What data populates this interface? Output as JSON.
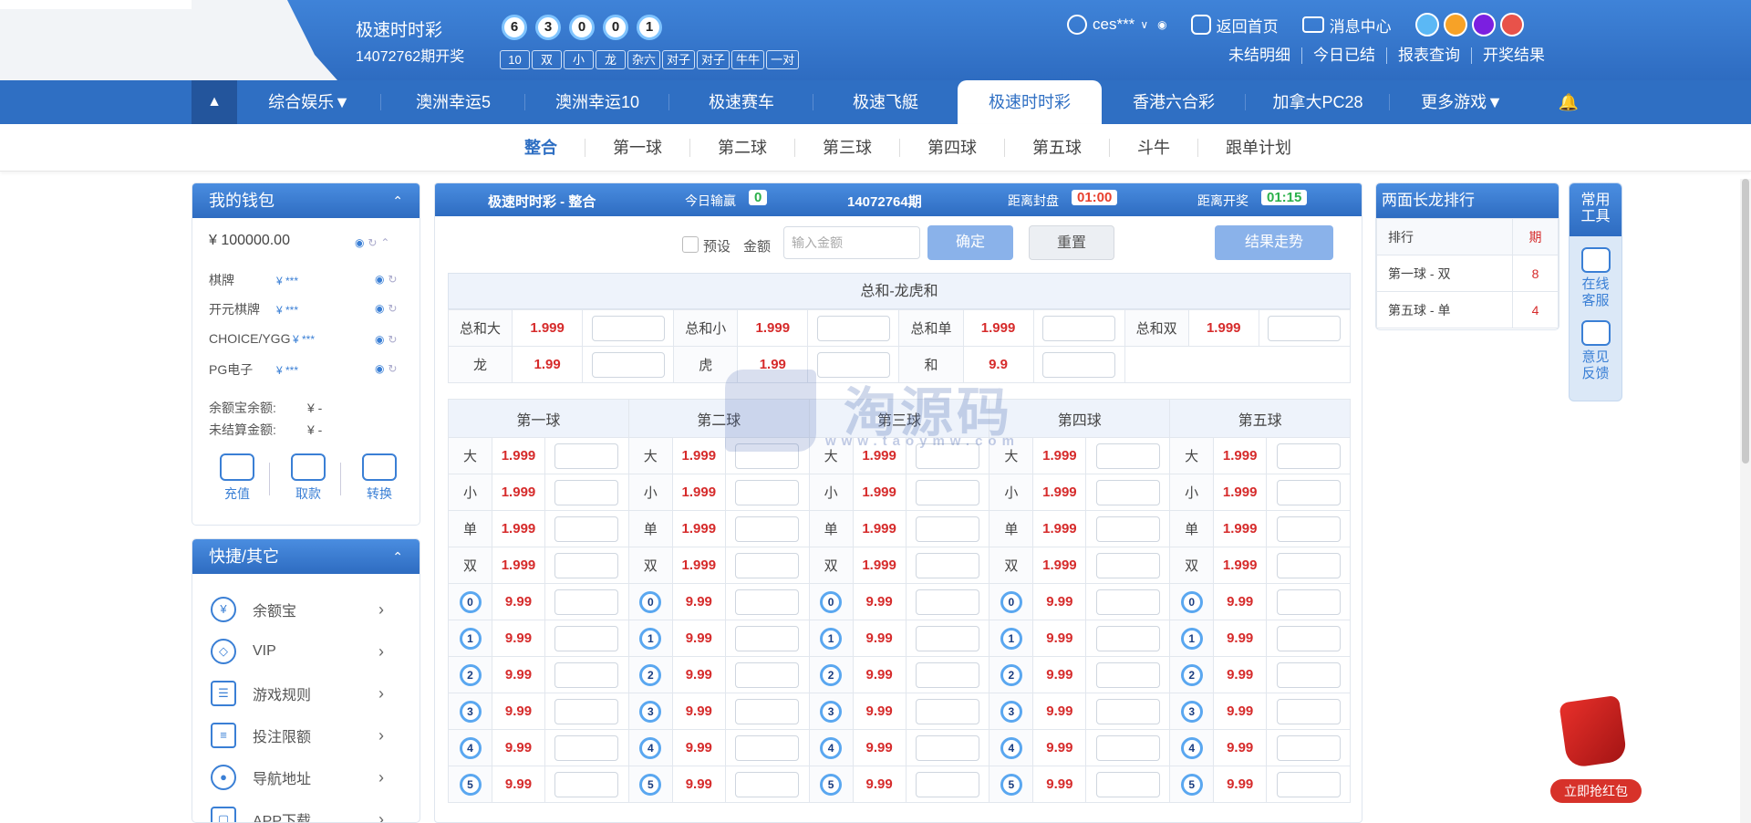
{
  "header": {
    "game_name": "极速时时彩",
    "period_open": "14072762期开奖",
    "balls": [
      "6",
      "3",
      "0",
      "0",
      "1"
    ],
    "tags": [
      "10",
      "双",
      "小",
      "龙",
      "杂六",
      "对子",
      "对子",
      "牛牛",
      "一对"
    ],
    "user": "ces***",
    "home_link": "返回首页",
    "message_center": "消息中心",
    "theme_colors": [
      "#5bb8f5",
      "#f7a227",
      "#7b1fe0",
      "#e8524a"
    ],
    "links": [
      "未结明细",
      "今日已结",
      "报表查询",
      "开奖结果"
    ]
  },
  "nav": {
    "items": [
      {
        "label": "综合娱乐▼"
      },
      {
        "label": "澳洲幸运5"
      },
      {
        "label": "澳洲幸运10"
      },
      {
        "label": "极速赛车"
      },
      {
        "label": "极速飞艇"
      },
      {
        "label": "极速时时彩",
        "active": true
      },
      {
        "label": "香港六合彩"
      },
      {
        "label": "加拿大PC28"
      },
      {
        "label": "更多游戏▼"
      }
    ]
  },
  "subnav": {
    "items": [
      "整合",
      "第一球",
      "第二球",
      "第三球",
      "第四球",
      "第五球",
      "斗牛",
      "跟单计划"
    ],
    "active": "整合"
  },
  "wallet": {
    "title": "我的钱包",
    "balance": "¥ 100000.00",
    "accounts": [
      {
        "name": "棋牌",
        "value": "¥ ***"
      },
      {
        "name": "开元棋牌",
        "value": "¥ ***"
      },
      {
        "name": "CHOICE/YGG",
        "value": "¥ ***"
      },
      {
        "name": "PG电子",
        "value": "¥ ***"
      }
    ],
    "yuebao_label": "余额宝余额:",
    "yuebao_value": "¥ -",
    "unsettled_label": "未结算金额:",
    "unsettled_value": "¥ -",
    "buttons": [
      "充值",
      "取款",
      "转换"
    ]
  },
  "quick": {
    "title": "快捷/其它",
    "items": [
      {
        "label": "余额宝",
        "icon": "coin-bag-icon"
      },
      {
        "label": "VIP",
        "icon": "diamond-icon"
      },
      {
        "label": "游戏规则",
        "icon": "rules-icon"
      },
      {
        "label": "投注限额",
        "icon": "sliders-icon"
      },
      {
        "label": "导航地址",
        "icon": "location-icon"
      },
      {
        "label": "APP下载",
        "icon": "app-icon"
      }
    ]
  },
  "main": {
    "title": "极速时时彩 - 整合",
    "today_label": "今日输赢",
    "today_value": "0",
    "period": "14072764期",
    "close_label": "距离封盘",
    "close_time": "01:00",
    "open_label": "距离开奖",
    "open_time": "01:15",
    "preset_label": "预设",
    "amount_label": "金额",
    "amount_placeholder": "输入金额",
    "confirm": "确定",
    "reset": "重置",
    "trend": "结果走势",
    "sum_title": "总和-龙虎和",
    "sum_row1": [
      {
        "label": "总和大",
        "odds": "1.999"
      },
      {
        "label": "总和小",
        "odds": "1.999"
      },
      {
        "label": "总和单",
        "odds": "1.999"
      },
      {
        "label": "总和双",
        "odds": "1.999"
      }
    ],
    "sum_row2": [
      {
        "label": "龙",
        "odds": "1.99"
      },
      {
        "label": "虎",
        "odds": "1.99"
      },
      {
        "label": "和",
        "odds": "9.9"
      }
    ],
    "ball_heads": [
      "第一球",
      "第二球",
      "第三球",
      "第四球",
      "第五球"
    ],
    "bsd": [
      {
        "label": "大",
        "odds": "1.999"
      },
      {
        "label": "小",
        "odds": "1.999"
      },
      {
        "label": "单",
        "odds": "1.999"
      },
      {
        "label": "双",
        "odds": "1.999"
      }
    ],
    "num_odds": "9.99",
    "numbers": [
      "0",
      "1",
      "2",
      "3",
      "4",
      "5"
    ]
  },
  "long_rank": {
    "title": "两面长龙排行",
    "col1": "排行",
    "col2": "期",
    "rows": [
      {
        "name": "第一球 - 双",
        "count": "8"
      },
      {
        "name": "第五球 - 单",
        "count": "4"
      }
    ]
  },
  "tools": {
    "title": "常用工具",
    "items": [
      "在线客服",
      "意见反馈"
    ]
  },
  "redpack": "立即抢红包",
  "watermark": {
    "main": "淘源码",
    "sub": "www.taoymw.com"
  }
}
